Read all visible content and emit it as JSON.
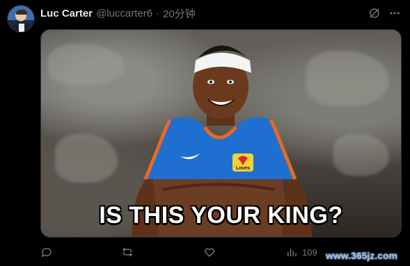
{
  "tweet": {
    "author_name": "Luc Carter",
    "handle": "@luccarter6",
    "separator": "·",
    "time": "20分钟",
    "media_caption": "IS THIS YOUR KING?",
    "jersey_logo": "Loves",
    "views_count": "109"
  },
  "watermark": "www.365jz.com",
  "icons": {
    "grok": "grok-icon",
    "more": "more-icon",
    "reply": "reply-icon",
    "retweet": "retweet-icon",
    "like": "heart-icon",
    "views": "views-chart-icon",
    "bookmark": "bookmark-icon",
    "share": "share-icon"
  },
  "colors": {
    "background": "#000000",
    "text_primary": "#e7e9ea",
    "text_secondary": "#71767b",
    "jersey_blue": "#1f6fd1",
    "jersey_orange": "#e86a24"
  }
}
